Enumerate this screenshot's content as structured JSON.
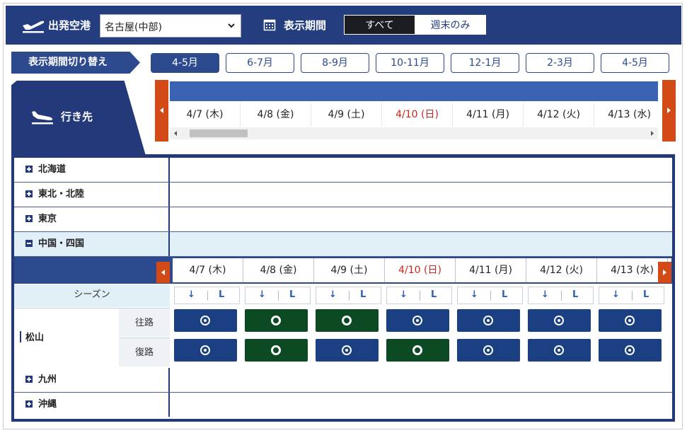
{
  "header": {
    "departure_label": "出発空港",
    "airport_value": "名古屋(中部)",
    "period_label": "表示期間",
    "segment_all": "すべて",
    "segment_weekend": "週末のみ"
  },
  "period_switch": {
    "label": "表示期間切り替え",
    "months": [
      "4-5月",
      "6-7月",
      "8-9月",
      "10-11月",
      "12-1月",
      "2-3月",
      "4-5月"
    ],
    "active_index": 0
  },
  "destination_header": "行き先",
  "dates": [
    {
      "label": "4/7 (木)",
      "holiday": false
    },
    {
      "label": "4/8 (金)",
      "holiday": false
    },
    {
      "label": "4/9 (土)",
      "holiday": false
    },
    {
      "label": "4/10 (日)",
      "holiday": true
    },
    {
      "label": "4/11 (月)",
      "holiday": false
    },
    {
      "label": "4/12 (火)",
      "holiday": false
    },
    {
      "label": "4/13 (水)",
      "holiday": false
    }
  ],
  "regions": [
    {
      "name": "北海道",
      "expanded": false
    },
    {
      "name": "東北・北陸",
      "expanded": false
    },
    {
      "name": "東京",
      "expanded": false
    },
    {
      "name": "中国・四国",
      "expanded": true
    },
    {
      "name": "九州",
      "expanded": false
    },
    {
      "name": "沖縄",
      "expanded": false
    }
  ],
  "season_label": "シーズン",
  "season_marks": {
    "arrow": "↓",
    "letter": "L"
  },
  "city": {
    "name": "松山",
    "outbound_label": "往路",
    "return_label": "復路",
    "outbound": [
      "dot",
      "ring",
      "ring",
      "dot",
      "dot",
      "dot",
      "dot"
    ],
    "return": [
      "dot",
      "ring",
      "dot",
      "ring",
      "dot",
      "dot",
      "dot"
    ]
  },
  "colors": {
    "navy": "#23397a",
    "button_blue": "#1b3f83",
    "green": "#0b4a22",
    "holiday_red": "#c8281e",
    "scroll_orange": "#d34a17"
  }
}
